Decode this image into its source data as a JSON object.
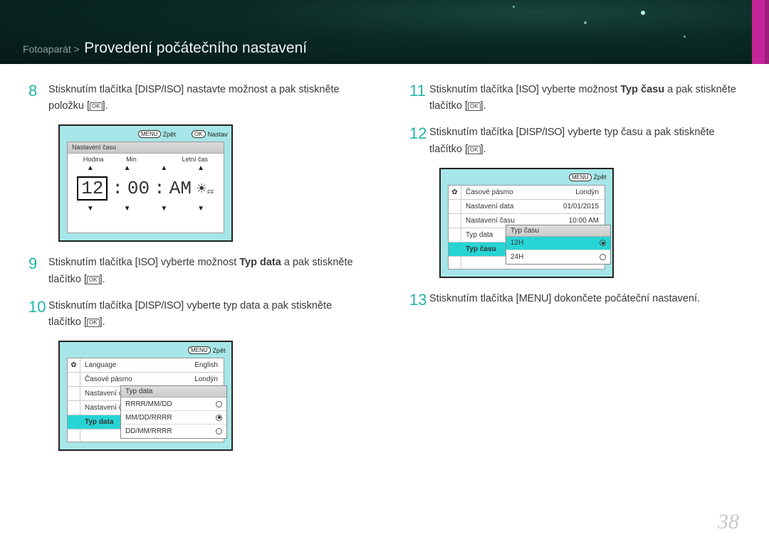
{
  "header": {
    "breadcrumb_section": "Fotoaparát >",
    "breadcrumb_title": "Provedení počátečního nastavení"
  },
  "steps": {
    "s8": {
      "num": "8",
      "a": "Stisknutím tlačítka [",
      "btn": "DISP/ISO",
      "b": "] nastavte možnost a pak stiskněte položku [",
      "c": "]."
    },
    "s9": {
      "num": "9",
      "a": "Stisknutím tlačítka [",
      "btn": "ISO",
      "b": "] vyberte možnost ",
      "bold": "Typ data",
      "c": " a pak stiskněte tlačítko [",
      "d": "]."
    },
    "s10": {
      "num": "10",
      "a": "Stisknutím tlačítka [",
      "btn": "DISP/ISO",
      "b": "] vyberte typ data a pak stiskněte tlačítko [",
      "c": "]."
    },
    "s11": {
      "num": "11",
      "a": "Stisknutím tlačítka [",
      "btn": "ISO",
      "b": "] vyberte možnost ",
      "bold": "Typ času",
      "c": " a pak stiskněte tlačítko [",
      "d": "]."
    },
    "s12": {
      "num": "12",
      "a": "Stisknutím tlačítka [",
      "btn": "DISP/ISO",
      "b": "] vyberte typ času a pak stiskněte tlačítko [",
      "c": "]."
    },
    "s13": {
      "num": "13",
      "a": "Stisknutím tlačítka [",
      "btn": "MENU",
      "b": "] dokončete počáteční nastavení."
    }
  },
  "lcd1": {
    "menu_back": "Zpět",
    "ok_set": "Nastav",
    "title": "Nastavení času",
    "cols": {
      "hour": "Hodina",
      "min": "Min",
      "dst": "Letní čas"
    },
    "hour": "12",
    "minute": "00",
    "ampm": "AM"
  },
  "lcd2": {
    "menu_back": "Zpět",
    "rows": [
      {
        "label": "Language",
        "value": "English"
      },
      {
        "label": "Časové pásmo",
        "value": "Londýn"
      },
      {
        "label": "Nastavení data",
        "value": ""
      },
      {
        "label": "Nastavení času",
        "value": ""
      },
      {
        "label": "Typ data",
        "value": ""
      }
    ],
    "popup_title": "Typ data",
    "options": [
      {
        "label": "RRRR/MM/DD",
        "sel": false
      },
      {
        "label": "MM/DD/RRRR",
        "sel": true
      },
      {
        "label": "DD/MM/RRRR",
        "sel": false
      }
    ]
  },
  "lcd3": {
    "menu_back": "Zpět",
    "rows": [
      {
        "label": "Časové pásmo",
        "value": "Londýn"
      },
      {
        "label": "Nastavení data",
        "value": "01/01/2015"
      },
      {
        "label": "Nastavení času",
        "value": "10:00 AM"
      },
      {
        "label": "Typ data",
        "value": ""
      },
      {
        "label": "Typ času",
        "value": ""
      }
    ],
    "popup_title": "Typ času",
    "options": [
      {
        "label": "12H",
        "sel": true
      },
      {
        "label": "24H",
        "sel": false
      }
    ]
  },
  "page_number": "38",
  "ok_label": "OK",
  "menu_pill": "MENU",
  "ok_pill": "OK"
}
